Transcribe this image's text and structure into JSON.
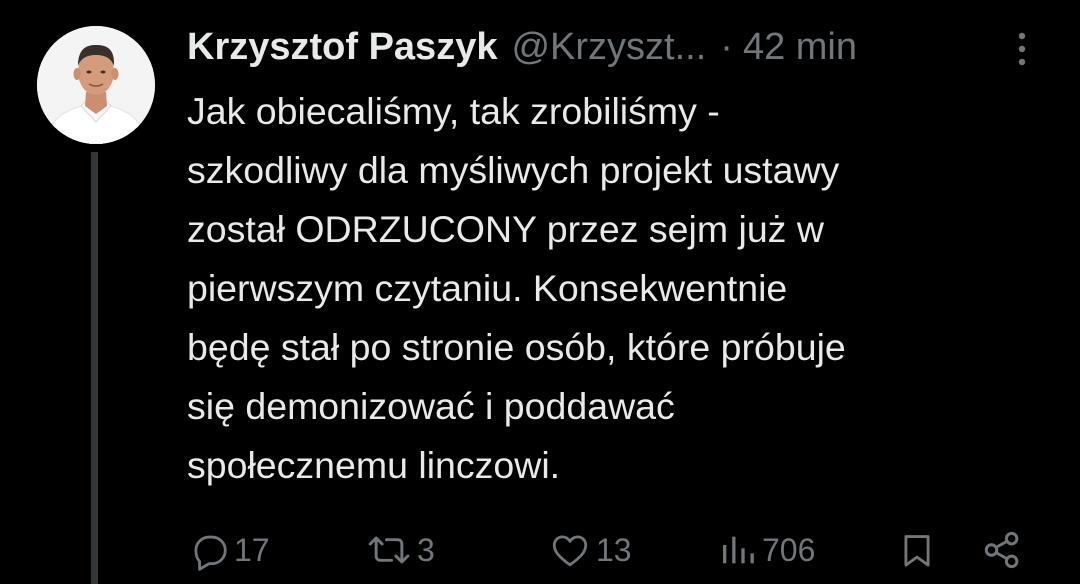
{
  "tweet": {
    "author_name": "Krzysztof Paszyk",
    "author_handle": "@Krzyszt...",
    "separator": "·",
    "time": "42 min",
    "text_lines": [
      "Jak obiecaliśmy, tak zrobiliśmy -",
      "szkodliwy dla myśliwych projekt ustawy",
      "został ODRZUCONY przez sejm już w",
      "pierwszym czytaniu. Konsekwentnie",
      "będę stał po stronie osób, które próbuje",
      "się demonizować i poddawać",
      "społecznemu linczowi."
    ]
  },
  "actions": {
    "replies": "17",
    "retweets": "3",
    "likes": "13",
    "views": "706"
  },
  "icons": {
    "more": "more-vertical-icon",
    "reply": "reply-icon",
    "retweet": "retweet-icon",
    "like": "heart-icon",
    "views": "views-chart-icon",
    "bookmark": "bookmark-icon",
    "share": "share-icon"
  },
  "colors": {
    "background": "#000000",
    "text_primary": "#e7e9ea",
    "text_secondary": "#71767b",
    "thread_line": "#333639"
  }
}
